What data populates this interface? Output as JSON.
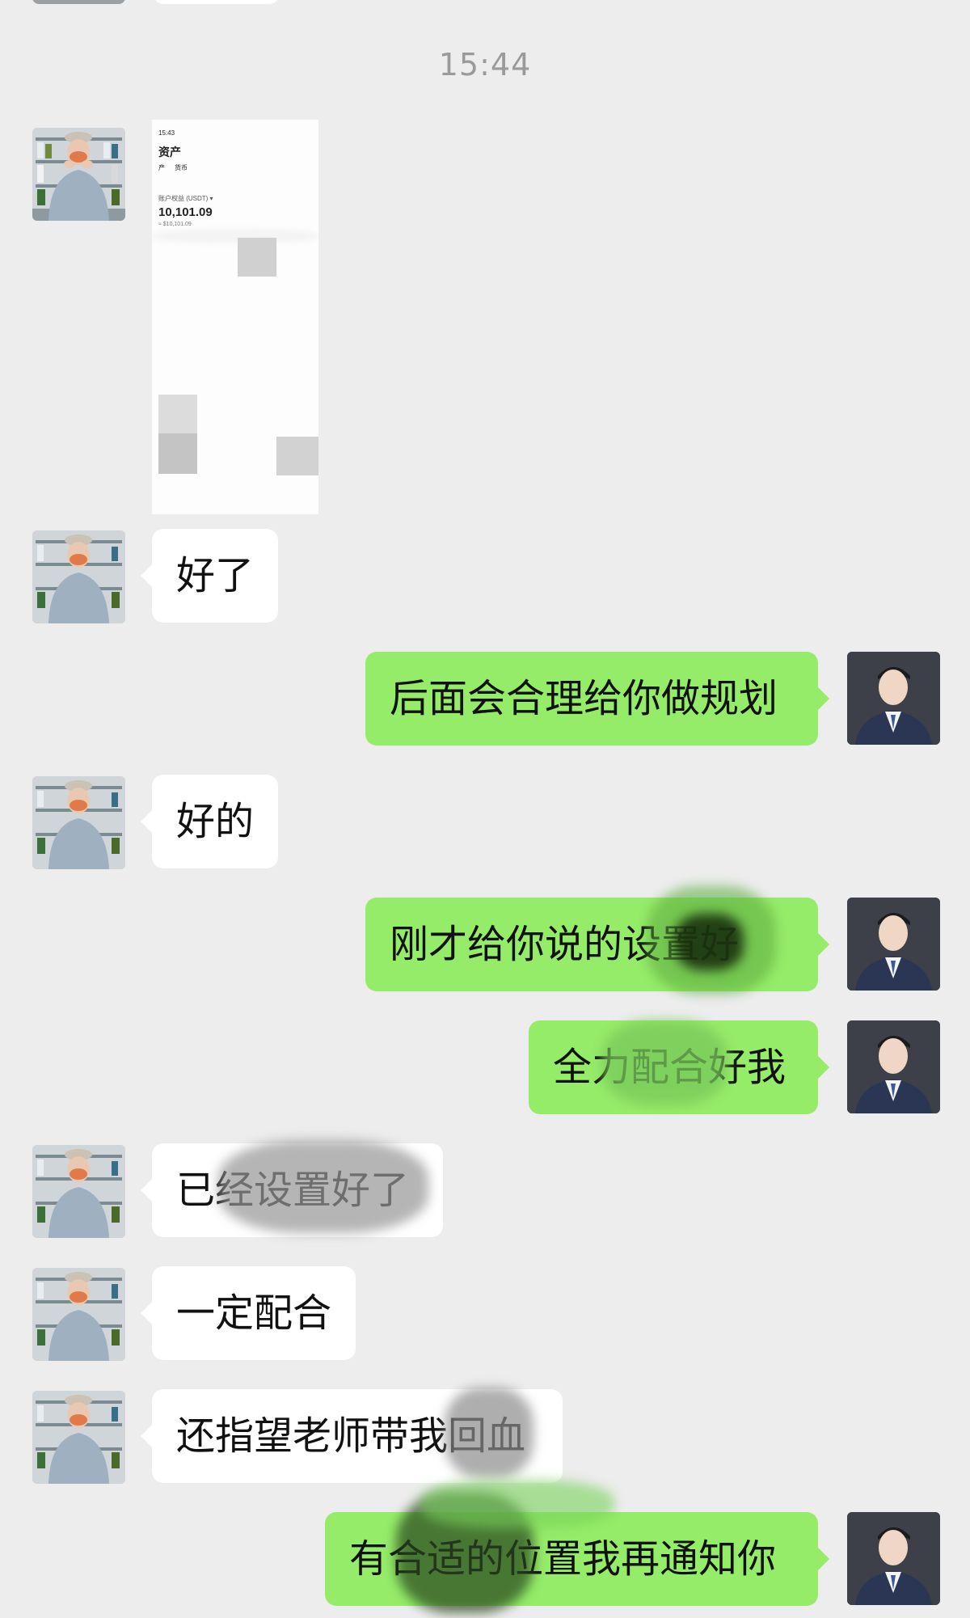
{
  "time_divider": "15:44",
  "shared_screenshot": {
    "time": "15:43",
    "title": "资产",
    "tab_1": "产",
    "tab_2": "货币",
    "equity_label": "账户权益 (USDT) ▾",
    "equity_value": "10,101.09",
    "equity_approx": "≈ $10,101.09"
  },
  "messages": [
    {
      "sender": "user",
      "text": "好了"
    },
    {
      "sender": "advisor",
      "text": "后面会合理给你做规划"
    },
    {
      "sender": "user",
      "text": "好的"
    },
    {
      "sender": "advisor",
      "text": "刚才给你说的设置好"
    },
    {
      "sender": "advisor",
      "text": "全力配合好我"
    },
    {
      "sender": "user",
      "text": "已经设置好了"
    },
    {
      "sender": "user",
      "text": "一定配合"
    },
    {
      "sender": "user",
      "text": "还指望老师带我回血"
    },
    {
      "sender": "advisor",
      "text": "有合适的位置我再通知你"
    }
  ],
  "colors": {
    "background": "#ededed",
    "incoming_bubble": "#ffffff",
    "outgoing_bubble": "#95ec69",
    "time_text": "#9a9a9a"
  }
}
